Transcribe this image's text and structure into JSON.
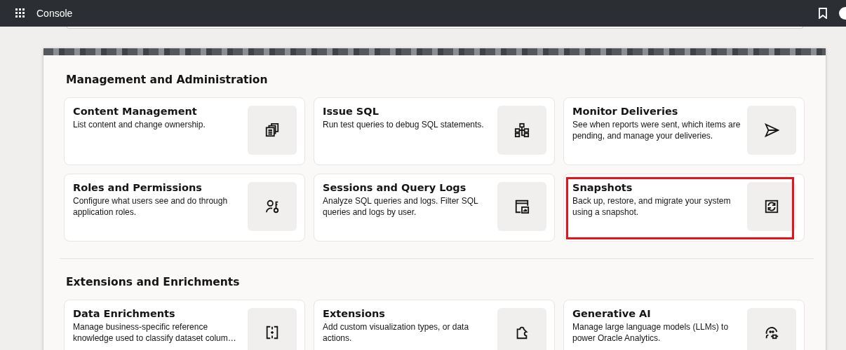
{
  "header": {
    "title": "Console"
  },
  "sections": [
    {
      "heading": "Management and Administration",
      "cards": [
        {
          "title": "Content Management",
          "description": "List content and change ownership.",
          "kind": "content",
          "highlighted": false
        },
        {
          "title": "Issue SQL",
          "description": "Run test queries to debug SQL statements.",
          "kind": "sql",
          "highlighted": false
        },
        {
          "title": "Monitor Deliveries",
          "description": "See when reports were sent, which items are pending, and manage your deliveries.",
          "kind": "send",
          "highlighted": false
        },
        {
          "title": "Roles and Permissions",
          "description": "Configure what users see and do through application roles.",
          "kind": "roles",
          "highlighted": false
        },
        {
          "title": "Sessions and Query Logs",
          "description": "Analyze SQL queries and logs. Filter SQL queries and logs by user.",
          "kind": "logs",
          "highlighted": false
        },
        {
          "title": "Snapshots",
          "description": "Back up, restore, and migrate your system using a snapshot.",
          "kind": "snapshot",
          "highlighted": true
        }
      ]
    },
    {
      "heading": "Extensions and Enrichments",
      "cards": [
        {
          "title": "Data Enrichments",
          "description": "Manage business-specific reference knowledge used to classify dataset colum…",
          "kind": "enrich",
          "highlighted": false
        },
        {
          "title": "Extensions",
          "description": "Add custom visualization types, or data actions.",
          "kind": "extension",
          "highlighted": false
        },
        {
          "title": "Generative AI",
          "description": "Manage large language models (LLMs) to power Oracle Analytics.",
          "kind": "ai",
          "highlighted": false
        }
      ]
    }
  ]
}
